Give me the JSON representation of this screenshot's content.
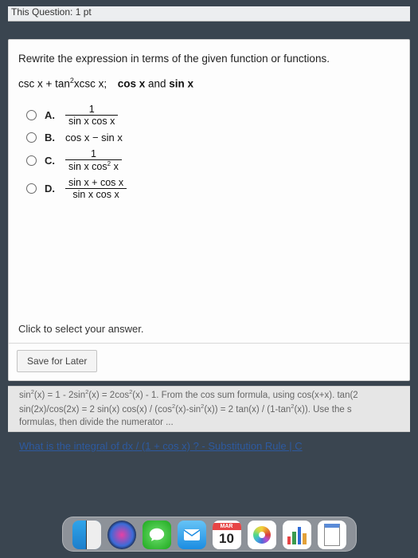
{
  "top_fragment": "This Question: 1 pt",
  "prompt": "Rewrite the expression in terms of the given function or functions.",
  "expression_html": "csc x + tan<sup>2</sup>xcsc x; <b>cos x</b> and <b>sin x</b>",
  "choices": [
    {
      "label": "A.",
      "num": "1",
      "den": "sin x cos x"
    },
    {
      "label": "B.",
      "plain": "cos x −  sin x"
    },
    {
      "label": "C.",
      "num": "1",
      "den": "sin x cos<sup>2</sup> x"
    },
    {
      "label": "D.",
      "num": "sin x +  cos x",
      "den": "sin x cos x"
    }
  ],
  "click_text": "Click to select your answer.",
  "save_label": "Save for Later",
  "below_html": "sin<sup>2</sup>(x) = 1 - 2sin<sup>2</sup>(x) = 2cos<sup>2</sup>(x) - 1. From the cos sum formula, using cos(x+x). tan(2<br>sin(2x)/cos(2x) = 2 sin(x) cos(x) / (cos<sup>2</sup>(x)-sin<sup>2</sup>(x)) = 2 tan(x) / (1-tan<sup>2</sup>(x)). Use the s<br>formulas, then divide the numerator ...",
  "question_line": "What is the integral of dx / (1 + cos x) ? - Substitution Rule | C",
  "calendar": {
    "month": "MAR",
    "day": "10"
  }
}
